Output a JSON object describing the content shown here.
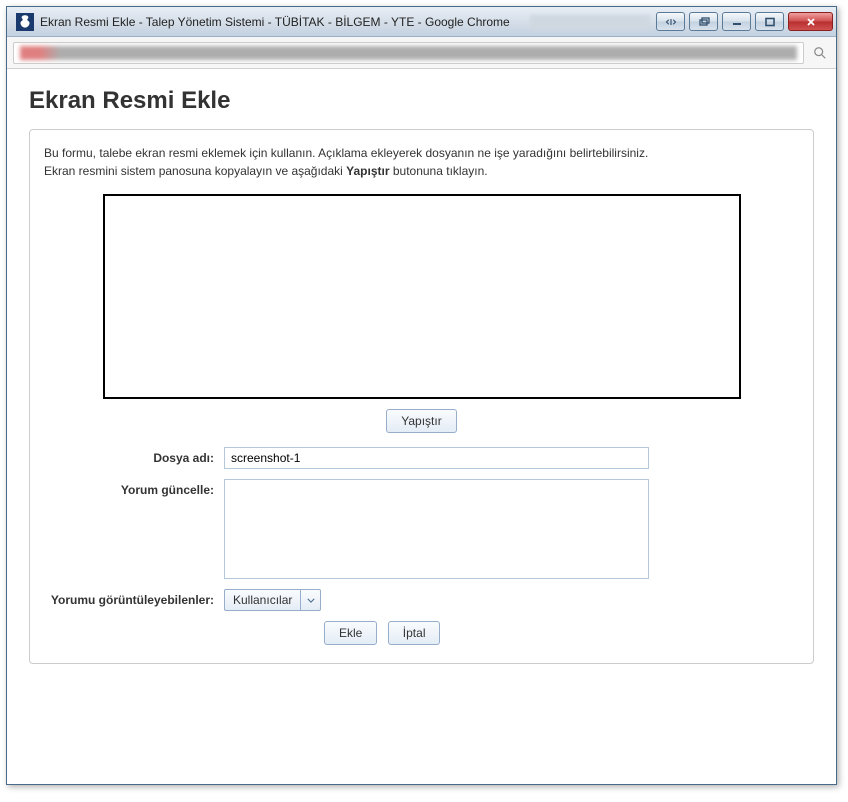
{
  "window": {
    "title": "Ekran Resmi Ekle - Talep Yönetim Sistemi - TÜBİTAK - BİLGEM - YTE - Google Chrome"
  },
  "page": {
    "heading": "Ekran Resmi Ekle",
    "desc_line1": "Bu formu, talebe ekran resmi eklemek için kullanın. Açıklama ekleyerek dosyanın ne işe yaradığını belirtebilirsiniz.",
    "desc_line2_before": "Ekran resmini sistem panosuna kopyalayın ve aşağıdaki ",
    "desc_line2_bold": "Yapıştır",
    "desc_line2_after": " butonuna tıklayın."
  },
  "buttons": {
    "paste": "Yapıştır",
    "add": "Ekle",
    "cancel": "İptal"
  },
  "form": {
    "filename_label": "Dosya adı:",
    "filename_value": "screenshot-1",
    "comment_label": "Yorum güncelle:",
    "comment_value": "",
    "viewers_label": "Yorumu görüntüleyebilenler:",
    "viewers_value": "Kullanıcılar"
  }
}
